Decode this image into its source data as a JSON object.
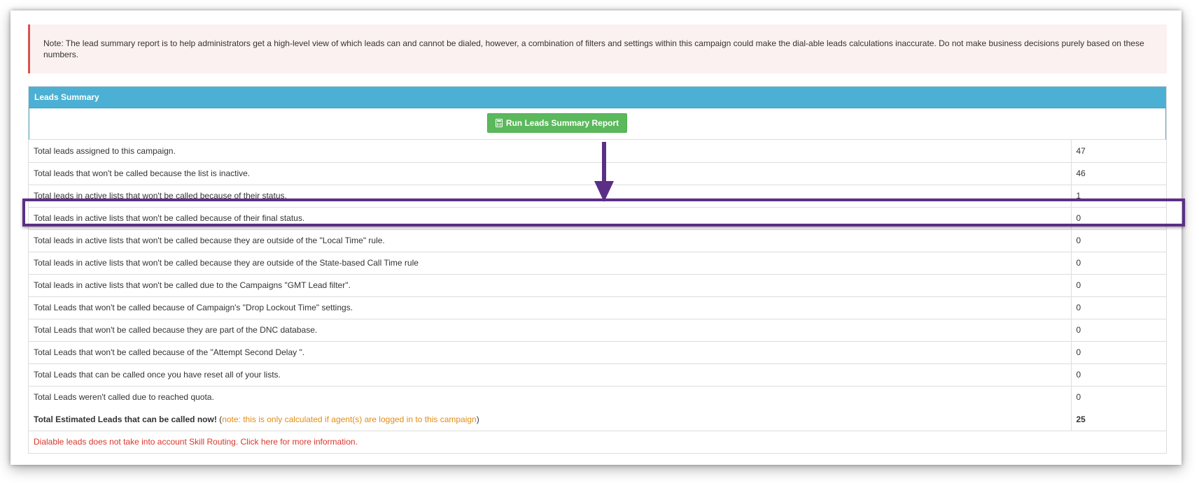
{
  "note": {
    "text": "Note: The lead summary report is to help administrators get a high-level view of which leads can and cannot be dialed, however, a combination of filters and settings within this campaign could make the dial-able leads calculations inaccurate. Do not make business decisions purely based on these numbers."
  },
  "panel": {
    "title": "Leads Summary",
    "run_button": {
      "label": "Run Leads Summary Report",
      "icon": "calculator-icon"
    }
  },
  "rows": [
    {
      "label": "Total leads assigned to this campaign.",
      "value": "47"
    },
    {
      "label": "Total leads that won't be called because the list is inactive.",
      "value": "46"
    },
    {
      "label": "Total leads in active lists that won't be called because of their status.",
      "value": "1"
    },
    {
      "label": "Total leads in active lists that won't be called because of their final status.",
      "value": "0"
    },
    {
      "label": "Total leads in active lists that won't be called because they are outside of the \"Local Time\" rule.",
      "value": "0"
    },
    {
      "label": "Total leads in active lists that won't be called because they are outside of the State-based Call Time rule",
      "value": "0"
    },
    {
      "label": "Total leads in active lists that won't be called due to the Campaigns \"GMT Lead filter\".",
      "value": "0"
    },
    {
      "label": "Total Leads that won't be called because of Campaign's \"Drop Lockout Time\" settings.",
      "value": "0"
    },
    {
      "label": "Total Leads that won't be called because they are part of the DNC database.",
      "value": "0"
    },
    {
      "label": "Total Leads that won't be called because of the \"Attempt Second Delay \".",
      "value": "0"
    },
    {
      "label": "Total Leads that can be called once you have reset all of your lists.",
      "value": "0"
    },
    {
      "label": "Total Leads weren't called due to reached quota.",
      "value": "0"
    }
  ],
  "total": {
    "label": "Total Estimated Leads that can be called now!",
    "open_paren": " (",
    "note": "note: this is only calculated if agent(s) are logged in to this campaign",
    "close_paren": ")",
    "value": "25"
  },
  "footer_link": "Dialable leads does not take into account Skill Routing. Click here for more information.",
  "colors": {
    "panel_heading": "#4bb0d3",
    "button": "#5cb85c",
    "highlight": "#5b2f86",
    "note_bg": "#fbf1f0",
    "warning_text": "#e38d13",
    "link_red": "#d9362b"
  }
}
